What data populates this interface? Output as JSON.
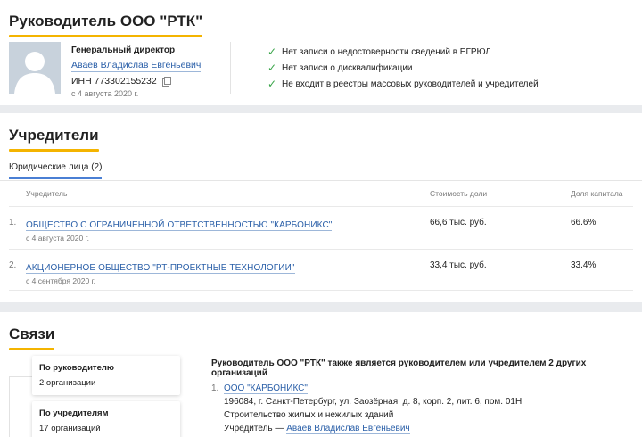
{
  "director": {
    "section_title": "Руководитель ООО \"РТК\"",
    "role": "Генеральный директор",
    "name": "Аваев Владислав Евгеньевич",
    "inn": "ИНН 773302155232",
    "since": "с 4 августа 2020 г.",
    "checks": [
      "Нет записи о недостоверности сведений в ЕГРЮЛ",
      "Нет записи о дисквалификации",
      "Не входит в реестры массовых руководителей и учредителей"
    ]
  },
  "founders": {
    "section_title": "Учредители",
    "tab_label": "Юридические лица (2)",
    "columns": [
      "Учредитель",
      "Стоимость доли",
      "Доля капитала"
    ],
    "rows": [
      {
        "num": "1.",
        "name": "ОБЩЕСТВО С ОГРАНИЧЕННОЙ ОТВЕТСТВЕННОСТЬЮ \"КАРБОНИКС\"",
        "date": "с 4 августа 2020 г.",
        "value": "66,6 тыс. руб.",
        "share": "66.6%"
      },
      {
        "num": "2.",
        "name": "АКЦИОНЕРНОЕ ОБЩЕСТВО \"РТ-ПРОЕКТНЫЕ ТЕХНОЛОГИИ\"",
        "date": "с 4 сентября 2020 г.",
        "value": "33,4 тыс. руб.",
        "share": "33.4%"
      }
    ]
  },
  "links": {
    "section_title": "Связи",
    "cards": [
      {
        "title": "По руководителю",
        "value": "2 организации"
      },
      {
        "title": "По учредителям",
        "value": "17 организаций"
      }
    ],
    "heading": "Руководитель ООО \"РТК\" также является руководителем или учредителем 2 других организаций",
    "items": [
      {
        "num": "1.",
        "name": "ООО \"КАРБОНИКС\"",
        "address": "196084, г. Санкт-Петербург, ул. Заозёрная, д. 8, корп. 2, лит. 6, пом. 01Н",
        "activity": "Строительство жилых и нежилых зданий",
        "founder_label": "Учредитель —",
        "founder_name": "Аваев Владислав Евгеньевич"
      }
    ]
  },
  "colors": {
    "accent": "#f4b400",
    "link": "#2a5fa8",
    "check": "#3aa54a",
    "tab": "#4a7fd4"
  }
}
